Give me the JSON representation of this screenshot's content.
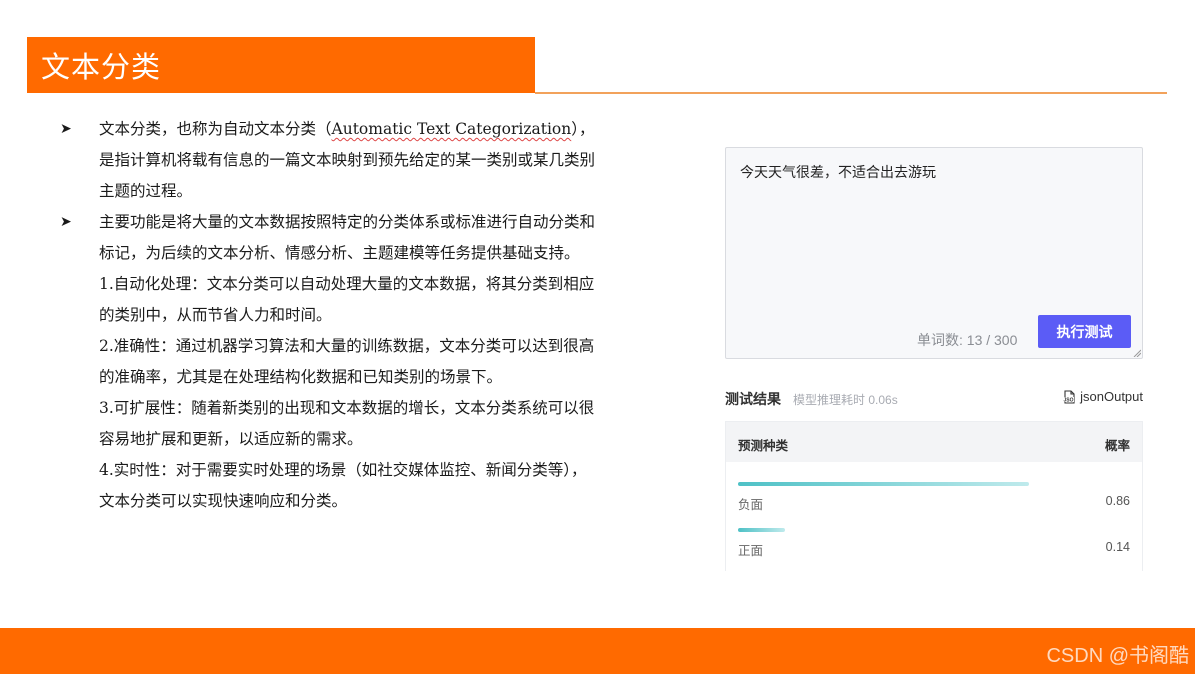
{
  "slide": {
    "title": "文本分类",
    "paragraphs": [
      {
        "type": "bullet",
        "lines": [
          "文本分类，也称为自动文本分类（",
          "Automatic Text Categorization",
          "），",
          "是指计算机将载有信息的一篇文本映射到预先给定的某一类别或某几类别",
          "主题的过程。"
        ]
      },
      {
        "type": "bullet",
        "lines": [
          "主要功能是将大量的文本数据按照特定的分类体系或标准进行自动分类和",
          "标记，为后续的文本分析、情感分析、主题建模等任务提供基础支持。"
        ]
      }
    ],
    "items": [
      [
        "1.自动化处理：文本分类可以自动处理大量的文本数据，将其分类到相应",
        "的类别中，从而节省人力和时间。"
      ],
      [
        "2.准确性：通过机器学习算法和大量的训练数据，文本分类可以达到很高",
        "的准确率，尤其是在处理结构化数据和已知类别的场景下。"
      ],
      [
        "3.可扩展性：随着新类别的出现和文本数据的增长，文本分类系统可以很",
        "容易地扩展和更新，以适应新的需求。"
      ],
      [
        "4.实时性：对于需要实时处理的场景（如社交媒体监控、新闻分类等），",
        "文本分类可以实现快速响应和分类。"
      ]
    ]
  },
  "demo": {
    "input_text": "今天天气很差，不适合出去游玩",
    "word_count": "单词数: 13 / 300",
    "run_button": "执行测试",
    "result_title": "测试结果",
    "result_time": "模型推理耗时 0.06s",
    "json_label": "jsonOutput",
    "table_head": {
      "left": "预测种类",
      "right": "概率"
    },
    "results": [
      {
        "label": "负面",
        "value": "0.86",
        "prob": 0.86
      },
      {
        "label": "正面",
        "value": "0.14",
        "prob": 0.14
      }
    ]
  },
  "watermark": "CSDN @书阁酷",
  "colors": {
    "accent": "#ff6a00",
    "button": "#5b5cf6",
    "bar": "#4ec1c6"
  }
}
